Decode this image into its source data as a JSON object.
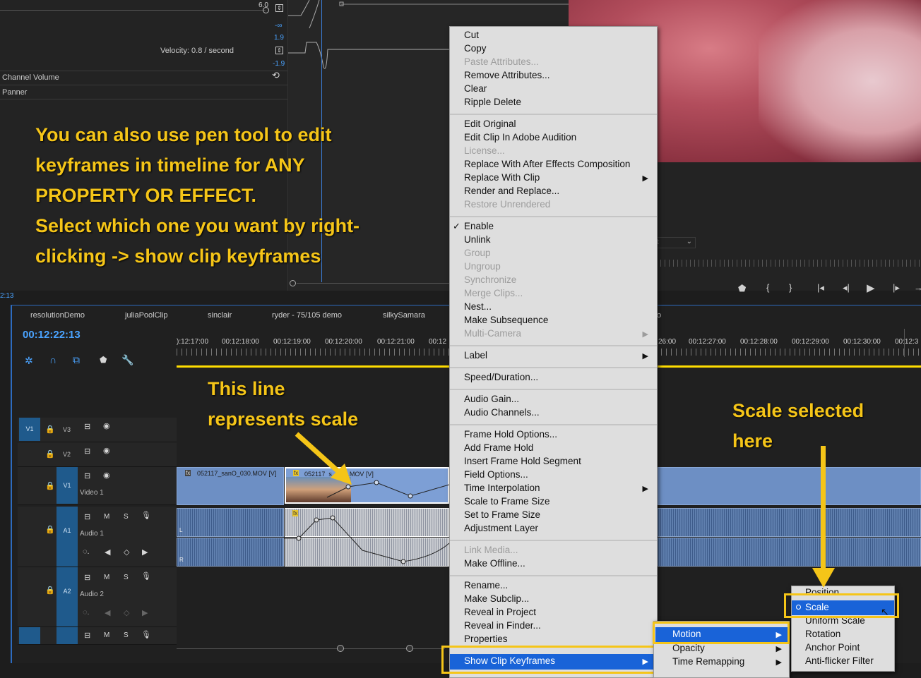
{
  "effect_controls": {
    "value_top": "6.0",
    "neg_inf": "-∞",
    "val_pos": "1.9",
    "velocity": "Velocity: 0.8 / second",
    "val_neg": "-1.9",
    "channel_volume": "Channel Volume",
    "panner": "Panner",
    "time_left": "2:13"
  },
  "annotations": {
    "main_line1": "You can also use pen tool to edit",
    "main_line2": "keyframes in timeline for ANY",
    "main_line3": "PROPERTY OR EFFECT.",
    "main_line4": "Select which one you want by right-",
    "main_line5": "clicking -> show clip keyframes",
    "line_note1": "This line",
    "line_note2": "represents scale",
    "scale_note1": "Scale selected",
    "scale_note2": "here",
    "accent_color": "#f5c518"
  },
  "monitor": {
    "fit_label": "t",
    "transport": [
      "marker-icon",
      "mark-in-icon",
      "mark-out-icon",
      "go-to-in-icon",
      "step-back-icon",
      "play-icon",
      "step-forward-icon",
      "go-to-out-icon"
    ]
  },
  "timeline": {
    "tabs": [
      "resolutionDemo",
      "juliaPoolClip",
      "sinclair",
      "ryder - 75/105 demo",
      "silkySamara",
      "o"
    ],
    "timecode": "00:12:22:13",
    "ruler_left": [
      "):12:17:00",
      "00:12:18:00",
      "00:12:19:00",
      "00:12:20:00",
      "00:12:21:00",
      "00:12"
    ],
    "ruler_right": [
      "26:00",
      "00:12:27:00",
      "00:12:28:00",
      "00:12:29:00",
      "00:12:30:00",
      "00:12:3"
    ],
    "tracks": {
      "v3": "V3",
      "v2": "V2",
      "v1": "V1",
      "v1_target": "V1",
      "v1_name": "Video 1",
      "a1": "A1",
      "a1_name": "Audio 1",
      "a2": "A2",
      "a2_name": "Audio 2"
    },
    "clip1_label": "052117_sanO_030.MOV [V]",
    "clip2_label": "052117_s...030.MOV [V]",
    "clip_fx": "fx",
    "channel_l": "L",
    "channel_r": "R",
    "track_m": "M",
    "track_s": "S",
    "highlight_color": "#1963d8"
  },
  "menu": {
    "items": {
      "cut": "Cut",
      "copy": "Copy",
      "paste_attr": "Paste Attributes...",
      "remove_attr": "Remove Attributes...",
      "clear": "Clear",
      "ripple_delete": "Ripple Delete",
      "edit_original": "Edit Original",
      "edit_audition": "Edit Clip In Adobe Audition",
      "license": "License...",
      "replace_ae": "Replace With After Effects Composition",
      "replace_clip": "Replace With Clip",
      "render_replace": "Render and Replace...",
      "restore": "Restore Unrendered",
      "enable": "Enable",
      "unlink": "Unlink",
      "group": "Group",
      "ungroup": "Ungroup",
      "synchronize": "Synchronize",
      "merge": "Merge Clips...",
      "nest": "Nest...",
      "make_subseq": "Make Subsequence",
      "multicam": "Multi-Camera",
      "label": "Label",
      "speed": "Speed/Duration...",
      "audio_gain": "Audio Gain...",
      "audio_channels": "Audio Channels...",
      "frame_hold_opts": "Frame Hold Options...",
      "add_frame_hold": "Add Frame Hold",
      "insert_frame_hold": "Insert Frame Hold Segment",
      "field_opts": "Field Options...",
      "time_interp": "Time Interpolation",
      "scale_frame": "Scale to Frame Size",
      "set_frame": "Set to Frame Size",
      "adjustment": "Adjustment Layer",
      "link_media": "Link Media...",
      "make_offline": "Make Offline...",
      "rename": "Rename...",
      "make_subclip": "Make Subclip...",
      "reveal_project": "Reveal in Project",
      "reveal_finder": "Reveal in Finder...",
      "properties": "Properties",
      "show_keyframes": "Show Clip Keyframes"
    },
    "checkmark": "✓",
    "submenu_arrow": "▶"
  },
  "submenu1": {
    "motion": "Motion",
    "opacity": "Opacity",
    "time_remap": "Time Remapping"
  },
  "submenu2": {
    "position": "Position",
    "scale": "Scale",
    "uniform": "Uniform Scale",
    "rotation": "Rotation",
    "anchor": "Anchor Point",
    "antiflicker": "Anti-flicker Filter"
  }
}
